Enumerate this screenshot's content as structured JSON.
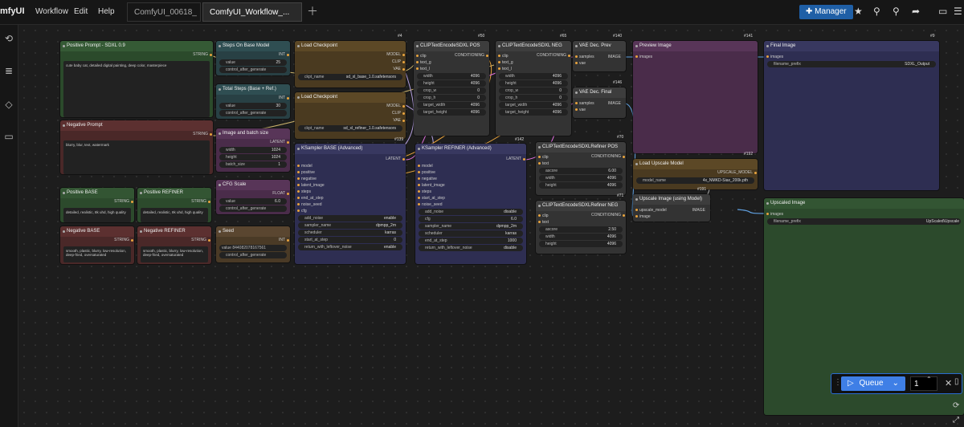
{
  "app": {
    "brand": "mfyUI",
    "menu": [
      "Workflow",
      "Edit",
      "Help"
    ]
  },
  "tabs": [
    {
      "label": "ComfyUI_00618_"
    },
    {
      "label": "ComfyUI_Workflow_..."
    }
  ],
  "toolbar": {
    "manager": "Manager"
  },
  "queue": {
    "label": "Queue",
    "count": "1"
  },
  "nodes": {
    "pos_prompt": {
      "title": "Positive Prompt - SDXL 0.9",
      "out": "STRING",
      "text": "cute baby cat, detailed digital painting, deep color, masterpiece"
    },
    "neg_prompt": {
      "title": "Negative Prompt",
      "out": "STRING",
      "text": "blurry, blur, text, watermark"
    },
    "pos_base": {
      "title": "Positive BASE",
      "out": "STRING",
      "text": "detailed, realistic, 8k uhd, high quality"
    },
    "pos_ref": {
      "title": "Positive REFINER",
      "out": "STRING",
      "text": "detailed, realistic, 8k uhd, high quality"
    },
    "neg_base": {
      "title": "Negative BASE",
      "out": "STRING",
      "text": "smooth, plastic, blurry, low-resolution, deep-fried, oversaturated"
    },
    "neg_ref": {
      "title": "Negative REFINER",
      "out": "STRING",
      "text": "smooth, plastic, blurry, low-resolution, deep-fried, oversaturated"
    },
    "steps_base": {
      "title": "Steps On Base Model",
      "out": "INT",
      "w1": "value",
      "v1": "25",
      "w2": "control_after_generate",
      "v2": "fixed"
    },
    "total_steps": {
      "title": "Total Steps (Base + Ref.)",
      "out": "INT",
      "w1": "value",
      "v1": "30",
      "w2": "control_after_generate",
      "v2": "fixed"
    },
    "img_batch": {
      "title": "Image and batch size",
      "out": "LATENT",
      "w1": "width",
      "v1": "1024",
      "w2": "height",
      "v2": "1024",
      "w3": "batch_size",
      "v3": "1"
    },
    "cfg": {
      "title": "CFG Scale",
      "out": "FLOAT",
      "w1": "value",
      "v1": "6.0",
      "w2": "control_after_generate",
      "v2": "fixed"
    },
    "seed": {
      "title": "Seed",
      "out": "INT",
      "w1": "value",
      "v1": "844082078167561",
      "w2": "control_after_generate",
      "v2": "fixed"
    },
    "ckpt1": {
      "title": "Load Checkpoint",
      "id": "#4",
      "o1": "MODEL",
      "o2": "CLIP",
      "o3": "VAE",
      "w1": "ckpt_name",
      "v1": "sd_xl_base_1.0.safetensors"
    },
    "ckpt2": {
      "title": "Load Checkpoint",
      "o1": "MODEL",
      "o2": "CLIP",
      "o3": "VAE",
      "w1": "ckpt_name",
      "v1": "sd_xl_refiner_1.0.safetensors"
    },
    "clip_pos": {
      "title": "CLIPTextEncodeSDXL POS",
      "id": "#50",
      "out": "CONDITIONING",
      "i1": "clip",
      "i2": "text_g",
      "i3": "text_l",
      "widgets": [
        [
          "width",
          "4096"
        ],
        [
          "height",
          "4096"
        ],
        [
          "crop_w",
          "0"
        ],
        [
          "crop_h",
          "0"
        ],
        [
          "target_width",
          "4096"
        ],
        [
          "target_height",
          "4096"
        ]
      ]
    },
    "clip_neg": {
      "title": "CLIPTextEncodeSDXL NEG",
      "id": "#65",
      "out": "CONDITIONING",
      "i1": "clip",
      "i2": "text_g",
      "i3": "text_l",
      "widgets": [
        [
          "width",
          "4096"
        ],
        [
          "height",
          "4096"
        ],
        [
          "crop_w",
          "0"
        ],
        [
          "crop_h",
          "0"
        ],
        [
          "target_width",
          "4096"
        ],
        [
          "target_height",
          "4096"
        ]
      ]
    },
    "vae_prev": {
      "title": "VAE Dec. Prev",
      "id": "#140",
      "i1": "samples",
      "i2": "vae",
      "out": "IMAGE"
    },
    "vae_final": {
      "title": "VAE Dec. Final",
      "id": "#146",
      "i1": "samples",
      "i2": "vae",
      "out": "IMAGE"
    },
    "preview": {
      "title": "Preview Image",
      "id": "#141",
      "i1": "images"
    },
    "final": {
      "title": "Final Image",
      "id": "#9",
      "i1": "images",
      "w1": "filename_prefix",
      "v1": "SDXL_Output"
    },
    "ks_base": {
      "title": "KSampler BASE (Advanced)",
      "id": "#139",
      "out": "LATENT",
      "inputs": [
        "model",
        "positive",
        "negative",
        "latent_image",
        "steps",
        "end_at_step",
        "noise_seed",
        "cfg"
      ],
      "widgets": [
        [
          "add_noise",
          "enable"
        ],
        [
          "sampler_name",
          "dpmpp_2m"
        ],
        [
          "scheduler",
          "karras"
        ],
        [
          "start_at_step",
          "0"
        ],
        [
          "return_with_leftover_noise",
          "enable"
        ]
      ]
    },
    "ks_ref": {
      "title": "KSampler REFINER (Advanced)",
      "id": "#142",
      "out": "LATENT",
      "inputs": [
        "model",
        "positive",
        "negative",
        "latent_image",
        "steps",
        "start_at_step",
        "noise_seed"
      ],
      "widgets": [
        [
          "add_noise",
          "disable"
        ],
        [
          "cfg",
          "6.0"
        ],
        [
          "sampler_name",
          "dpmpp_2m"
        ],
        [
          "scheduler",
          "karras"
        ],
        [
          "end_at_step",
          "1000"
        ],
        [
          "return_with_leftover_noise",
          "disable"
        ]
      ]
    },
    "ref_pos": {
      "title": "CLIPTextEncodeSDXLRefiner POS",
      "id": "#70",
      "out": "CONDITIONING",
      "i1": "clip",
      "i2": "text",
      "widgets": [
        [
          "ascore",
          "6.00"
        ],
        [
          "width",
          "4096"
        ],
        [
          "height",
          "4096"
        ]
      ]
    },
    "ref_neg": {
      "title": "CLIPTextEncodeSDXLRefiner NEG",
      "id": "#71",
      "out": "CONDITIONING",
      "i1": "clip",
      "i2": "text",
      "widgets": [
        [
          "ascore",
          "2.50"
        ],
        [
          "width",
          "4096"
        ],
        [
          "height",
          "4096"
        ]
      ]
    },
    "upscale_model": {
      "title": "Load Upscale Model",
      "id": "#192",
      "out": "UPSCALE_MODEL",
      "w1": "model_name",
      "v1": "4x_NMKD-Siax_200k.pth"
    },
    "upscale_img": {
      "title": "Upscale Image (using Model)",
      "id": "#191",
      "i1": "upscale_model",
      "i2": "image",
      "out": "IMAGE"
    },
    "upscaled": {
      "title": "Upscaled Image",
      "i1": "images",
      "w1": "filename_prefix",
      "v1": "UpScaled\\Upscale"
    }
  }
}
